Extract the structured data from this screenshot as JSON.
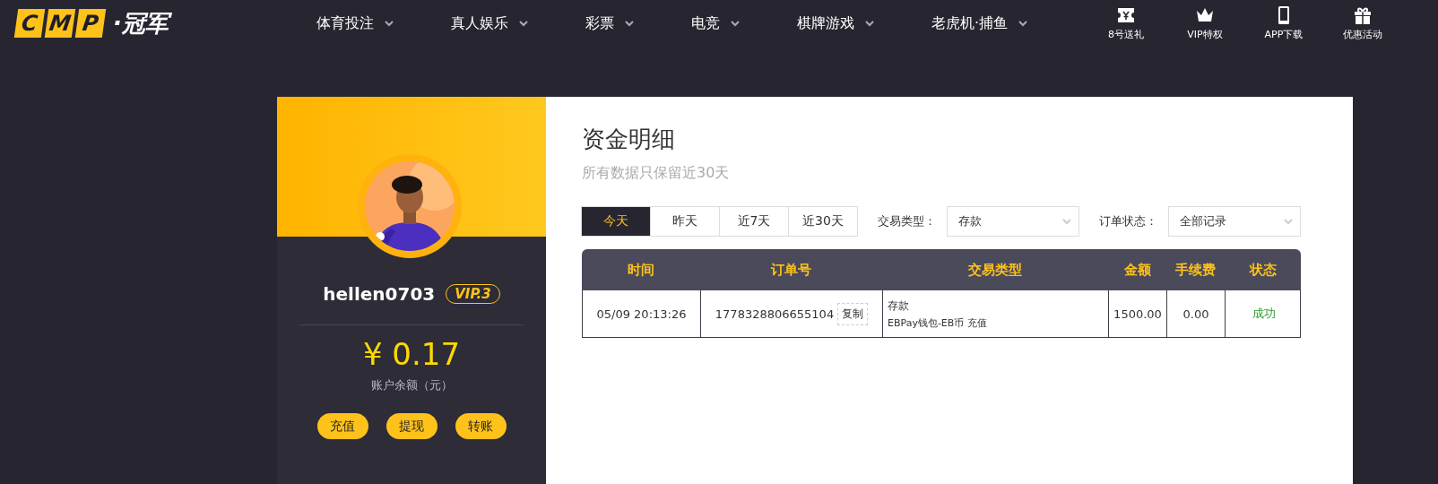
{
  "logo": {
    "letters": [
      "C",
      "M",
      "P"
    ],
    "text": "·冠军"
  },
  "nav": [
    {
      "label": "体育投注"
    },
    {
      "label": "真人娱乐"
    },
    {
      "label": "彩票"
    },
    {
      "label": "电竞"
    },
    {
      "label": "棋牌游戏"
    },
    {
      "label": "老虎机·捕鱼"
    }
  ],
  "quick_links": [
    {
      "label": "8号送礼",
      "kind": "ticket"
    },
    {
      "label": "VIP特权",
      "kind": "crown"
    },
    {
      "label": "APP下载",
      "kind": "tablet"
    },
    {
      "label": "优惠活动",
      "kind": "gift"
    }
  ],
  "profile": {
    "username": "hellen0703",
    "vip": "VIP.3",
    "balance": "¥ 0.17",
    "balance_label": "账户余额（元）",
    "actions": [
      "充值",
      "提现",
      "转账"
    ]
  },
  "records": {
    "title": "资金明细",
    "subtitle": "所有数据只保留近30天",
    "ranges": [
      {
        "label": "今天",
        "selected": true
      },
      {
        "label": "昨天",
        "selected": false
      },
      {
        "label": "近7天",
        "selected": false
      },
      {
        "label": "近30天",
        "selected": false
      }
    ],
    "filters": [
      {
        "label": "交易类型：",
        "value": "存款"
      },
      {
        "label": "订单状态：",
        "value": "全部记录"
      }
    ],
    "columns": [
      "时间",
      "订单号",
      "交易类型",
      "金额",
      "手续费",
      "状态"
    ],
    "rows": [
      {
        "time": "05/09 20:13:26",
        "order": "1778328806655104",
        "copy": "复制",
        "type": "存款",
        "type_detail": "EBPay钱包-EB币 充值",
        "amount": "1500.00",
        "fee": "0.00",
        "status": "成功",
        "success": true
      }
    ]
  }
}
